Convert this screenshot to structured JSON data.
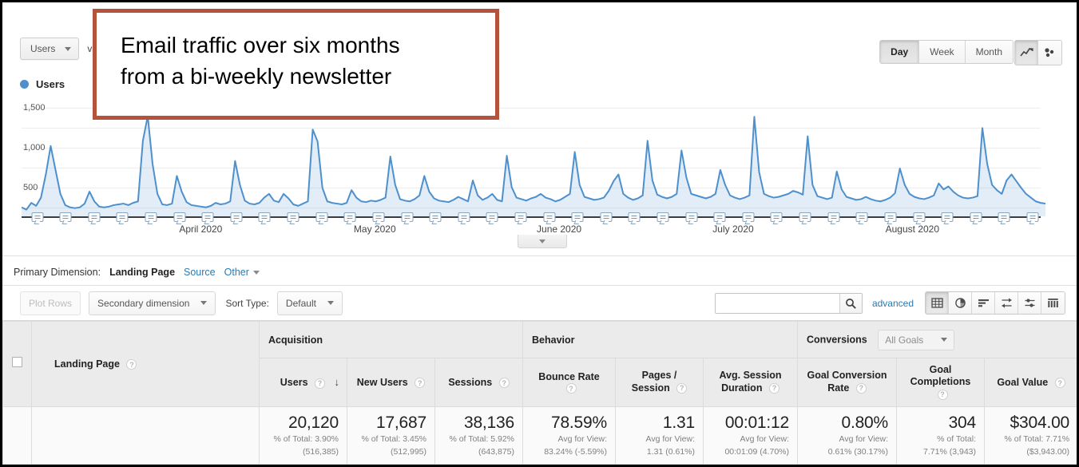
{
  "chart": {
    "metric_selector": "Users",
    "vs_label": "vs",
    "legend_label": "Users",
    "granularity": {
      "options": [
        "Day",
        "Week",
        "Month"
      ],
      "selected": "Day"
    },
    "viz_icons": [
      "line-chart-icon",
      "scatter-chart-icon"
    ],
    "viz_selected": "line-chart-icon",
    "y_ticks": [
      "1,500",
      "1,000",
      "500"
    ],
    "x_labels": [
      "April 2020",
      "May 2020",
      "June 2020",
      "July 2020",
      "August 2020"
    ],
    "collapse_icon": "chevron-down-icon"
  },
  "annotation": {
    "text": "Email traffic over six months\nfrom a bi-weekly newsletter",
    "border_color": "#b5523c"
  },
  "chart_data": {
    "type": "area",
    "title": "Users",
    "xlabel": "",
    "ylabel": "Users",
    "ylim": [
      0,
      1600
    ],
    "yticks": [
      500,
      1000,
      1500
    ],
    "grid": true,
    "legend": [
      "Users"
    ],
    "series_color": "#4d90cd",
    "x_tick_labels": [
      "April 2020",
      "May 2020",
      "June 2020",
      "July 2020",
      "August 2020"
    ],
    "x_tick_positions": [
      0.175,
      0.345,
      0.525,
      0.695,
      0.87
    ],
    "series": [
      {
        "name": "Users",
        "values": [
          120,
          90,
          180,
          140,
          250,
          560,
          940,
          620,
          300,
          150,
          120,
          110,
          120,
          170,
          330,
          200,
          130,
          120,
          130,
          150,
          160,
          170,
          150,
          180,
          200,
          1010,
          1340,
          700,
          300,
          160,
          150,
          170,
          540,
          330,
          190,
          150,
          140,
          130,
          120,
          140,
          180,
          160,
          170,
          200,
          740,
          420,
          210,
          170,
          160,
          180,
          250,
          300,
          210,
          190,
          300,
          240,
          160,
          140,
          170,
          200,
          1160,
          1000,
          380,
          200,
          180,
          170,
          160,
          180,
          350,
          250,
          200,
          190,
          210,
          200,
          220,
          250,
          800,
          420,
          230,
          210,
          200,
          230,
          280,
          540,
          330,
          240,
          210,
          200,
          190,
          220,
          260,
          230,
          200,
          480,
          280,
          220,
          250,
          300,
          220,
          200,
          810,
          390,
          250,
          230,
          210,
          240,
          260,
          300,
          250,
          230,
          200,
          220,
          260,
          300,
          860,
          420,
          260,
          240,
          220,
          230,
          250,
          340,
          470,
          560,
          300,
          250,
          220,
          240,
          280,
          1010,
          480,
          290,
          260,
          240,
          260,
          300,
          880,
          520,
          300,
          280,
          260,
          240,
          260,
          300,
          620,
          420,
          280,
          250,
          230,
          250,
          280,
          1330,
          590,
          300,
          270,
          250,
          260,
          280,
          300,
          340,
          320,
          290,
          1070,
          420,
          270,
          250,
          230,
          250,
          600,
          360,
          260,
          240,
          220,
          230,
          260,
          230,
          210,
          200,
          220,
          250,
          310,
          640,
          420,
          300,
          260,
          240,
          230,
          250,
          280,
          440,
          360,
          400,
          330,
          280,
          250,
          240,
          250,
          270,
          1180,
          700,
          420,
          350,
          300,
          480,
          560,
          470,
          380,
          300,
          250,
          200,
          180,
          170
        ]
      }
    ],
    "annotation_marker_count": 36
  },
  "primary_dimension": {
    "label": "Primary Dimension:",
    "active": "Landing Page",
    "links": [
      "Source"
    ],
    "other": "Other"
  },
  "toolbar": {
    "plot_rows": "Plot Rows",
    "secondary_dimension": "Secondary dimension",
    "sort_type_label": "Sort Type:",
    "sort_type_value": "Default",
    "search_placeholder": "",
    "search_value": "",
    "search_icon": "search-icon",
    "advanced": "advanced",
    "view_icons": [
      "table-view-icon",
      "pie-view-icon",
      "bar-view-icon",
      "performance-view-icon",
      "comparison-view-icon",
      "pivot-view-icon"
    ],
    "view_selected": "table-view-icon"
  },
  "table": {
    "row_dimension_header": "Landing Page",
    "groups": [
      {
        "name": "Acquisition",
        "span": 3
      },
      {
        "name": "Behavior",
        "span": 3
      },
      {
        "name": "Conversions",
        "span": 3,
        "goal_selector": "All Goals"
      }
    ],
    "columns": [
      {
        "label": "Users",
        "sorted": true,
        "sort_icon": "arrow-down-icon"
      },
      {
        "label": "New Users"
      },
      {
        "label": "Sessions"
      },
      {
        "label": "Bounce Rate"
      },
      {
        "label": "Pages / Session"
      },
      {
        "label": "Avg. Session Duration"
      },
      {
        "label": "Goal Conversion Rate"
      },
      {
        "label": "Goal Completions"
      },
      {
        "label": "Goal Value"
      }
    ],
    "summary_row": [
      {
        "value": "20,120",
        "line1": "% of Total: 3.90%",
        "line2": "(516,385)"
      },
      {
        "value": "17,687",
        "line1": "% of Total: 3.45%",
        "line2": "(512,995)"
      },
      {
        "value": "38,136",
        "line1": "% of Total: 5.92%",
        "line2": "(643,875)"
      },
      {
        "value": "78.59%",
        "line1": "Avg for View:",
        "line2": "83.24% (-5.59%)"
      },
      {
        "value": "1.31",
        "line1": "Avg for View:",
        "line2": "1.31 (0.61%)"
      },
      {
        "value": "00:01:12",
        "line1": "Avg for View:",
        "line2": "00:01:09 (4.70%)"
      },
      {
        "value": "0.80%",
        "line1": "Avg for View:",
        "line2": "0.61% (30.17%)"
      },
      {
        "value": "304",
        "line1": "% of Total:",
        "line2": "7.71% (3,943)"
      },
      {
        "value": "$304.00",
        "line1": "% of Total: 7.71%",
        "line2": "($3,943.00)"
      }
    ]
  }
}
